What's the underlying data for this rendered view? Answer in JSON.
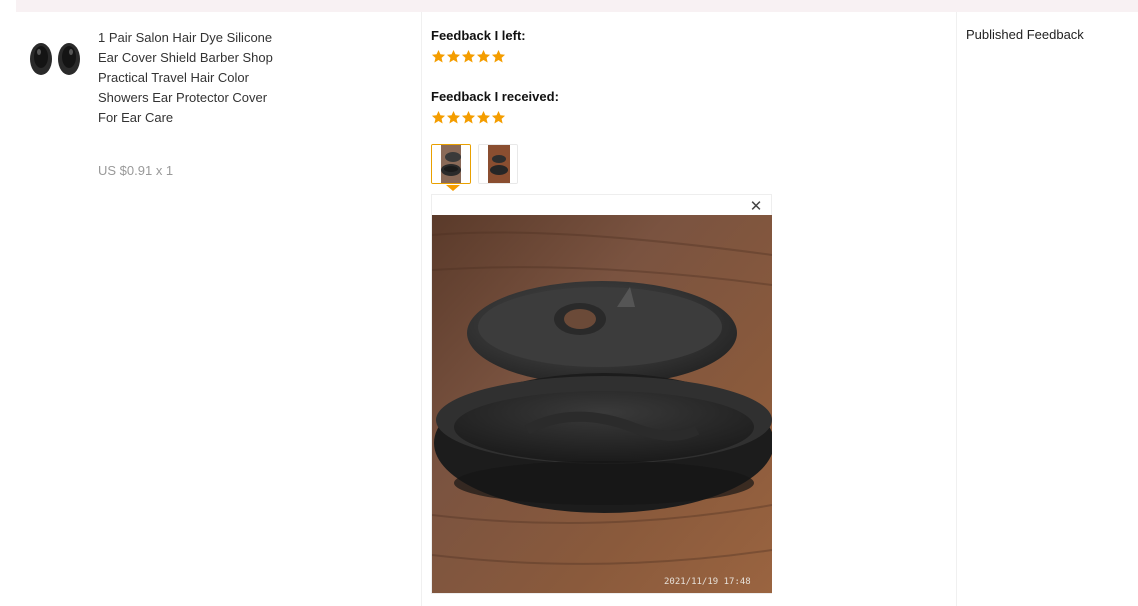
{
  "product": {
    "title": "1 Pair Salon Hair Dye Silicone Ear Cover Shield Barber Shop Practical Travel Hair Color Showers Ear Protector Cover For Ear Care",
    "price": "US $0.91 x 1"
  },
  "feedback": {
    "left_heading": "Feedback I left:",
    "left_rating": 5,
    "received_heading": "Feedback I received:",
    "received_rating": 5,
    "star_color": "#f49d00",
    "photos": [
      "ear-cover-photo-1",
      "ear-cover-photo-2"
    ],
    "active_photo_index": 0,
    "photo_timestamp": "2021/11/19  17:48"
  },
  "status": {
    "label": "Published Feedback"
  },
  "viewer": {
    "close_label": "✕"
  }
}
